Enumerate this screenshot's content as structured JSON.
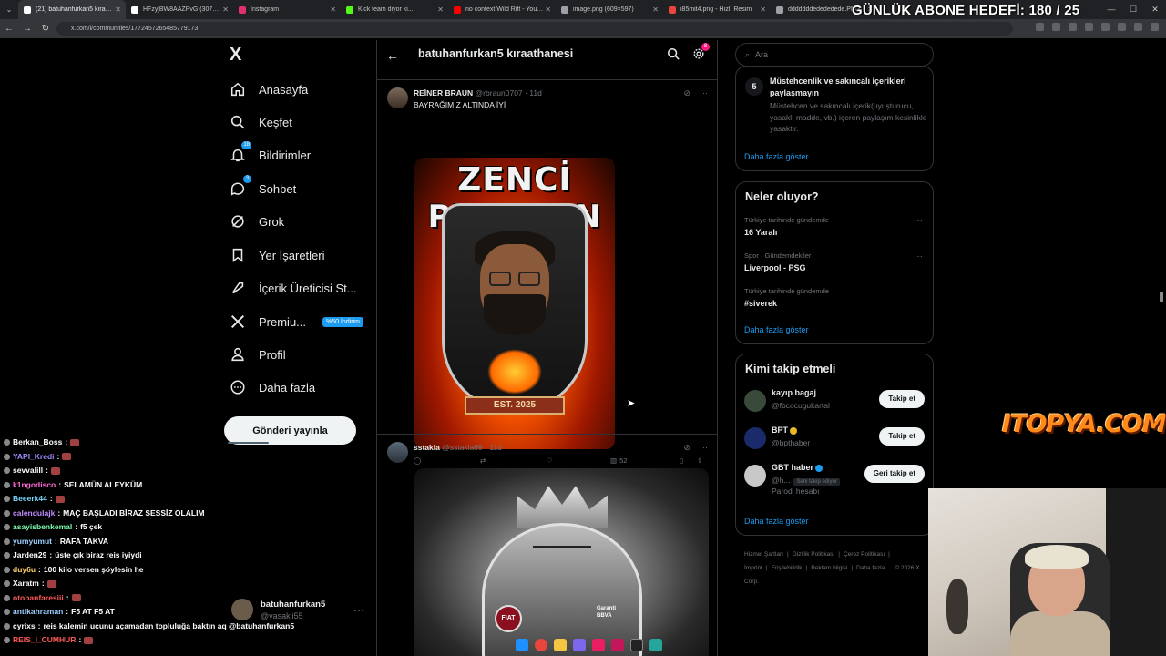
{
  "browser": {
    "tabs": [
      {
        "title": "(21) batuhanfurkan5 kıraathane",
        "color": "#ffffff",
        "active": true
      },
      {
        "title": "HFzyjBW8AAZPvG (3072×4096)",
        "color": "#ffffff",
        "active": false
      },
      {
        "title": "Instagram",
        "color": "#e1306c",
        "active": false
      },
      {
        "title": "Kick team diyor ki...",
        "color": "#53fc18",
        "active": false
      },
      {
        "title": "no context Wild Rift - YouTube",
        "color": "#ff0000",
        "active": false
      },
      {
        "title": "image.png (609×597)",
        "color": "#9aa0a6",
        "active": false
      },
      {
        "title": "i85mit4.png - Hızlı Resim",
        "color": "#e8453c",
        "active": false
      },
      {
        "title": "dddddddedededede.PNG",
        "color": "#9aa0a6",
        "active": false
      }
    ],
    "url": "x.com/i/communities/1772457265485779173"
  },
  "overlay": {
    "goal_text": "GÜNLÜK ABONE HEDEFİ: 180 / 25",
    "sponsor_logo": "ITOPYA.COM"
  },
  "chat": [
    {
      "user": "Berkan_Boss",
      "msg": "",
      "color": "#ffffff"
    },
    {
      "user": "YAPI_Kredi",
      "msg": "",
      "color": "#9b8cff"
    },
    {
      "user": "sevvalill",
      "msg": "",
      "color": "#ffffff"
    },
    {
      "user": "k1ngodisco",
      "msg": "SELAMÜN ALEYKÜM",
      "color": "#ff6ad5"
    },
    {
      "user": "Beeerk44",
      "msg": "",
      "color": "#7ad7ff"
    },
    {
      "user": "calendulajk",
      "msg": "MAÇ BAŞLADI BİRAZ SESSİZ OLALIM",
      "color": "#c08bff"
    },
    {
      "user": "asayisbenkemal",
      "msg": "f5 çek",
      "color": "#7affb0"
    },
    {
      "user": "yumyumut",
      "msg": "RAFA TAKVA",
      "color": "#9bd0ff"
    },
    {
      "user": "Jarden29",
      "msg": "üste çık biraz reis iyiydi",
      "color": "#ffffff"
    },
    {
      "user": "duy6u",
      "msg": "100 kilo versen şöylesin he",
      "color": "#ffd36a"
    },
    {
      "user": "Xaratm",
      "msg": "",
      "color": "#ffffff"
    },
    {
      "user": "otobanfaresiii",
      "msg": "",
      "color": "#ff5a5a"
    },
    {
      "user": "antikahraman",
      "msg": "F5 AT F5 AT",
      "color": "#9bd0ff"
    },
    {
      "user": "cyrixs",
      "msg": "reis kalemin ucunu açamadan topluluğa baktın aq @batuhanfurkan5",
      "color": "#ffffff"
    },
    {
      "user": "REIS_I_CUMHUR",
      "msg": "",
      "color": "#ff5a5a"
    }
  ],
  "xnav": {
    "logo": "X",
    "items": [
      {
        "label": "Anasayfa",
        "icon": "home-icon"
      },
      {
        "label": "Keşfet",
        "icon": "search-icon"
      },
      {
        "label": "Bildirimler",
        "icon": "bell-icon",
        "badge": "18"
      },
      {
        "label": "Sohbet",
        "icon": "chat-icon",
        "badge": "3"
      },
      {
        "label": "Grok",
        "icon": "grok-icon"
      },
      {
        "label": "Yer İşaretleri",
        "icon": "bookmark-icon"
      },
      {
        "label": "İçerik Üreticisi St...",
        "icon": "rocket-icon"
      },
      {
        "label": "Premiu...",
        "icon": "x-premium-icon",
        "promo": "%50 İndirim"
      },
      {
        "label": "Profil",
        "icon": "profile-icon"
      },
      {
        "label": "Daha fazla",
        "icon": "more-circle-icon"
      }
    ],
    "post_button": "Gönderi yayınla",
    "account": {
      "name": "batuhanfurkan5",
      "handle": "@yasakli55"
    }
  },
  "timeline": {
    "title": "batuhanfurkan5 kıraathanesi",
    "notif_count": "8",
    "tweets": [
      {
        "name": "REİNER BRAUN",
        "handle": "@rbraun0707",
        "time": "11d",
        "text": "BAYRAĞIMIZ ALTINDA İYİ",
        "image_text_1": "ZENCİ",
        "image_text_2": "PENGUEN",
        "image_text_3": "EST. 2025",
        "views": "52"
      },
      {
        "name": "sstakla",
        "handle": "@sstakla69",
        "time": "11d",
        "text": "",
        "image_text_1": "FIAT",
        "image_text_2": "Garanti BBVA"
      }
    ]
  },
  "right": {
    "search_placeholder": "Ara",
    "rule": {
      "number": "5",
      "title": "Müstehcenlik ve sakıncalı içerikleri paylaşmayın",
      "desc": "Müstehcen ve sakıncalı içerik(uyuşturucu, yasaklı madde, vb.) içeren paylaşım kesinlikle yasaktır."
    },
    "more_label": "Daha fazla göster",
    "trends_title": "Neler oluyor?",
    "trends": [
      {
        "context": "Türkiye tarihinde gündemde",
        "topic": "16 Yaralı"
      },
      {
        "context": "Spor · Gündemdekiler",
        "topic": "Liverpool - PSG"
      },
      {
        "context": "Türkiye tarihinde gündemde",
        "topic": "#siverek"
      }
    ],
    "follow_title": "Kimi takip etmeli",
    "follow": [
      {
        "name": "kayıp bagaj",
        "handle": "@fbcocugukartal",
        "button": "Takip et",
        "avatar_color": "#3a4a3a"
      },
      {
        "name": "BPT",
        "handle": "@bpthaber",
        "button": "Takip et",
        "avatar_color": "#1a2a6a",
        "verified": "#e8b923"
      },
      {
        "name": "GBT haber",
        "handle": "@h...",
        "button": "Geri takip et",
        "avatar_color": "#c8c8c8",
        "verified": "#1d9bf0",
        "follows_you": "Seni takip ediyor",
        "parody": "Parodi hesabı"
      }
    ],
    "footer": [
      "Hizmet Şartları",
      "Gizlilik Politikası",
      "Çerez Politikası",
      "İmprint",
      "Erişilebilirlik",
      "Reklam bilgisi",
      "Daha fazla ...",
      "© 2026 X Corp."
    ]
  }
}
